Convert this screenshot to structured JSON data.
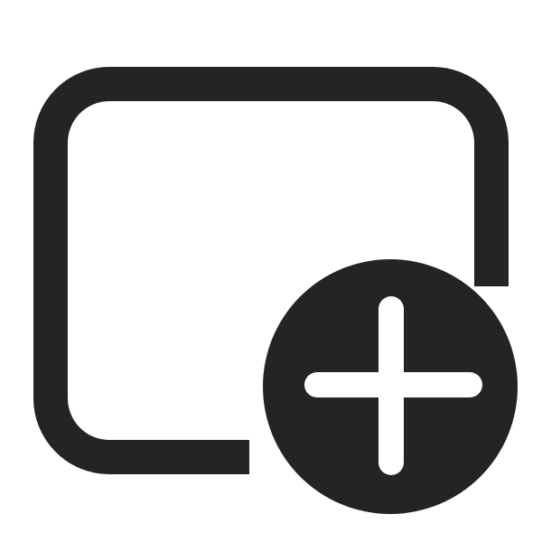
{
  "icon": {
    "name": "rectangle-add-icon",
    "color": "#242424",
    "background": "#ffffff"
  }
}
